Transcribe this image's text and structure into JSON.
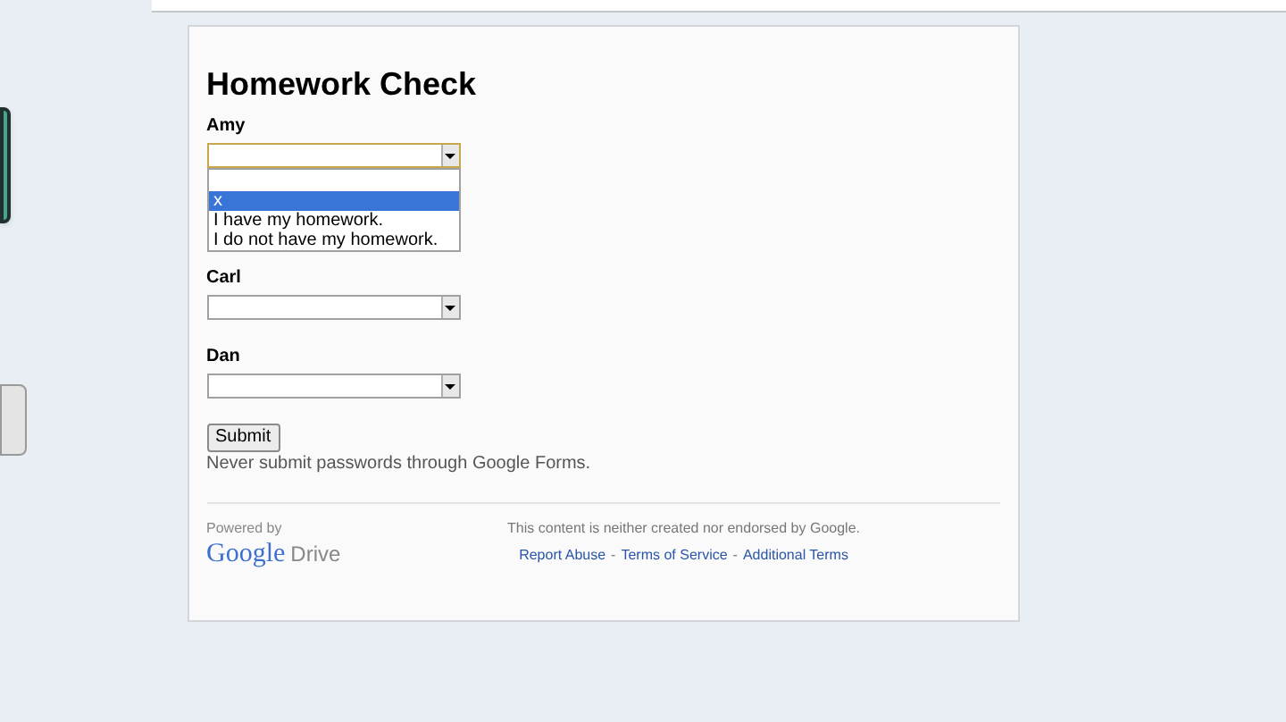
{
  "form": {
    "title": "Homework Check",
    "questions": [
      {
        "label": "Amy",
        "expanded": true,
        "options": [
          {
            "label": "x",
            "selected": true
          },
          {
            "label": "I have my homework.",
            "selected": false
          },
          {
            "label": "I do not have my homework.",
            "selected": false
          }
        ]
      },
      {
        "label": "Carl",
        "expanded": false
      },
      {
        "label": "Dan",
        "expanded": false
      }
    ],
    "submit": "Submit",
    "note": "Never submit passwords through Google Forms."
  },
  "footer": {
    "powered_by": "Powered by",
    "brand": "Google",
    "product": "Drive",
    "disclaimer": "This content is neither created nor endorsed by Google.",
    "links": [
      "Report Abuse",
      "Terms of Service",
      "Additional Terms"
    ],
    "separator": "-"
  }
}
